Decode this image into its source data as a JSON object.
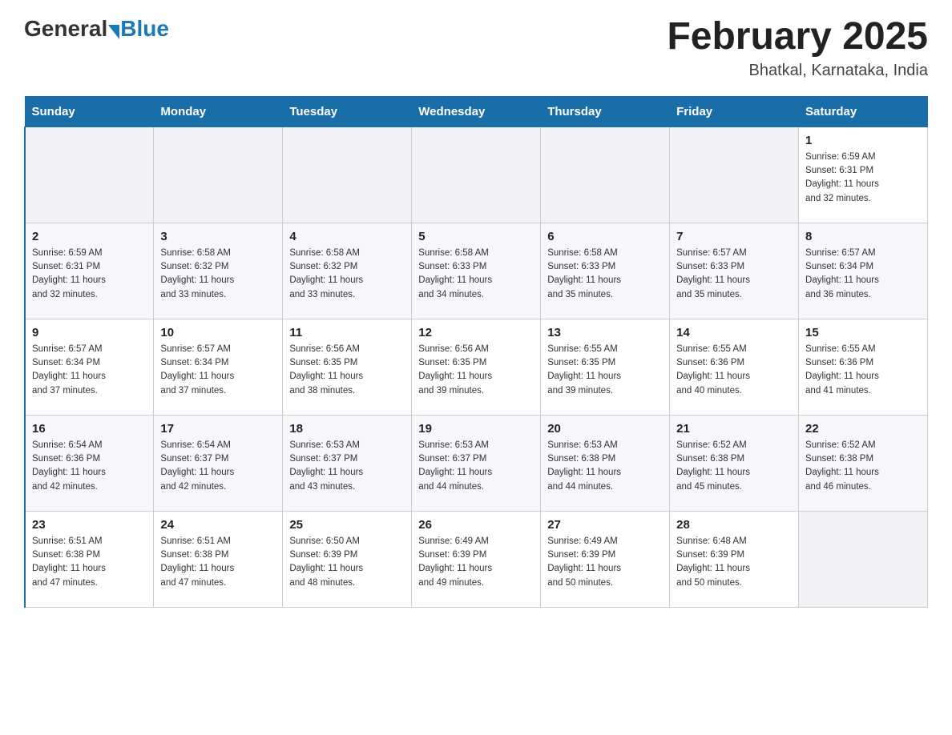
{
  "header": {
    "logo": {
      "general": "General",
      "blue": "Blue"
    },
    "title": "February 2025",
    "location": "Bhatkal, Karnataka, India"
  },
  "days_of_week": [
    "Sunday",
    "Monday",
    "Tuesday",
    "Wednesday",
    "Thursday",
    "Friday",
    "Saturday"
  ],
  "weeks": [
    {
      "days": [
        {
          "date": "",
          "info": ""
        },
        {
          "date": "",
          "info": ""
        },
        {
          "date": "",
          "info": ""
        },
        {
          "date": "",
          "info": ""
        },
        {
          "date": "",
          "info": ""
        },
        {
          "date": "",
          "info": ""
        },
        {
          "date": "1",
          "info": "Sunrise: 6:59 AM\nSunset: 6:31 PM\nDaylight: 11 hours\nand 32 minutes."
        }
      ]
    },
    {
      "days": [
        {
          "date": "2",
          "info": "Sunrise: 6:59 AM\nSunset: 6:31 PM\nDaylight: 11 hours\nand 32 minutes."
        },
        {
          "date": "3",
          "info": "Sunrise: 6:58 AM\nSunset: 6:32 PM\nDaylight: 11 hours\nand 33 minutes."
        },
        {
          "date": "4",
          "info": "Sunrise: 6:58 AM\nSunset: 6:32 PM\nDaylight: 11 hours\nand 33 minutes."
        },
        {
          "date": "5",
          "info": "Sunrise: 6:58 AM\nSunset: 6:33 PM\nDaylight: 11 hours\nand 34 minutes."
        },
        {
          "date": "6",
          "info": "Sunrise: 6:58 AM\nSunset: 6:33 PM\nDaylight: 11 hours\nand 35 minutes."
        },
        {
          "date": "7",
          "info": "Sunrise: 6:57 AM\nSunset: 6:33 PM\nDaylight: 11 hours\nand 35 minutes."
        },
        {
          "date": "8",
          "info": "Sunrise: 6:57 AM\nSunset: 6:34 PM\nDaylight: 11 hours\nand 36 minutes."
        }
      ]
    },
    {
      "days": [
        {
          "date": "9",
          "info": "Sunrise: 6:57 AM\nSunset: 6:34 PM\nDaylight: 11 hours\nand 37 minutes."
        },
        {
          "date": "10",
          "info": "Sunrise: 6:57 AM\nSunset: 6:34 PM\nDaylight: 11 hours\nand 37 minutes."
        },
        {
          "date": "11",
          "info": "Sunrise: 6:56 AM\nSunset: 6:35 PM\nDaylight: 11 hours\nand 38 minutes."
        },
        {
          "date": "12",
          "info": "Sunrise: 6:56 AM\nSunset: 6:35 PM\nDaylight: 11 hours\nand 39 minutes."
        },
        {
          "date": "13",
          "info": "Sunrise: 6:55 AM\nSunset: 6:35 PM\nDaylight: 11 hours\nand 39 minutes."
        },
        {
          "date": "14",
          "info": "Sunrise: 6:55 AM\nSunset: 6:36 PM\nDaylight: 11 hours\nand 40 minutes."
        },
        {
          "date": "15",
          "info": "Sunrise: 6:55 AM\nSunset: 6:36 PM\nDaylight: 11 hours\nand 41 minutes."
        }
      ]
    },
    {
      "days": [
        {
          "date": "16",
          "info": "Sunrise: 6:54 AM\nSunset: 6:36 PM\nDaylight: 11 hours\nand 42 minutes."
        },
        {
          "date": "17",
          "info": "Sunrise: 6:54 AM\nSunset: 6:37 PM\nDaylight: 11 hours\nand 42 minutes."
        },
        {
          "date": "18",
          "info": "Sunrise: 6:53 AM\nSunset: 6:37 PM\nDaylight: 11 hours\nand 43 minutes."
        },
        {
          "date": "19",
          "info": "Sunrise: 6:53 AM\nSunset: 6:37 PM\nDaylight: 11 hours\nand 44 minutes."
        },
        {
          "date": "20",
          "info": "Sunrise: 6:53 AM\nSunset: 6:38 PM\nDaylight: 11 hours\nand 44 minutes."
        },
        {
          "date": "21",
          "info": "Sunrise: 6:52 AM\nSunset: 6:38 PM\nDaylight: 11 hours\nand 45 minutes."
        },
        {
          "date": "22",
          "info": "Sunrise: 6:52 AM\nSunset: 6:38 PM\nDaylight: 11 hours\nand 46 minutes."
        }
      ]
    },
    {
      "days": [
        {
          "date": "23",
          "info": "Sunrise: 6:51 AM\nSunset: 6:38 PM\nDaylight: 11 hours\nand 47 minutes."
        },
        {
          "date": "24",
          "info": "Sunrise: 6:51 AM\nSunset: 6:38 PM\nDaylight: 11 hours\nand 47 minutes."
        },
        {
          "date": "25",
          "info": "Sunrise: 6:50 AM\nSunset: 6:39 PM\nDaylight: 11 hours\nand 48 minutes."
        },
        {
          "date": "26",
          "info": "Sunrise: 6:49 AM\nSunset: 6:39 PM\nDaylight: 11 hours\nand 49 minutes."
        },
        {
          "date": "27",
          "info": "Sunrise: 6:49 AM\nSunset: 6:39 PM\nDaylight: 11 hours\nand 50 minutes."
        },
        {
          "date": "28",
          "info": "Sunrise: 6:48 AM\nSunset: 6:39 PM\nDaylight: 11 hours\nand 50 minutes."
        },
        {
          "date": "",
          "info": ""
        }
      ]
    }
  ]
}
